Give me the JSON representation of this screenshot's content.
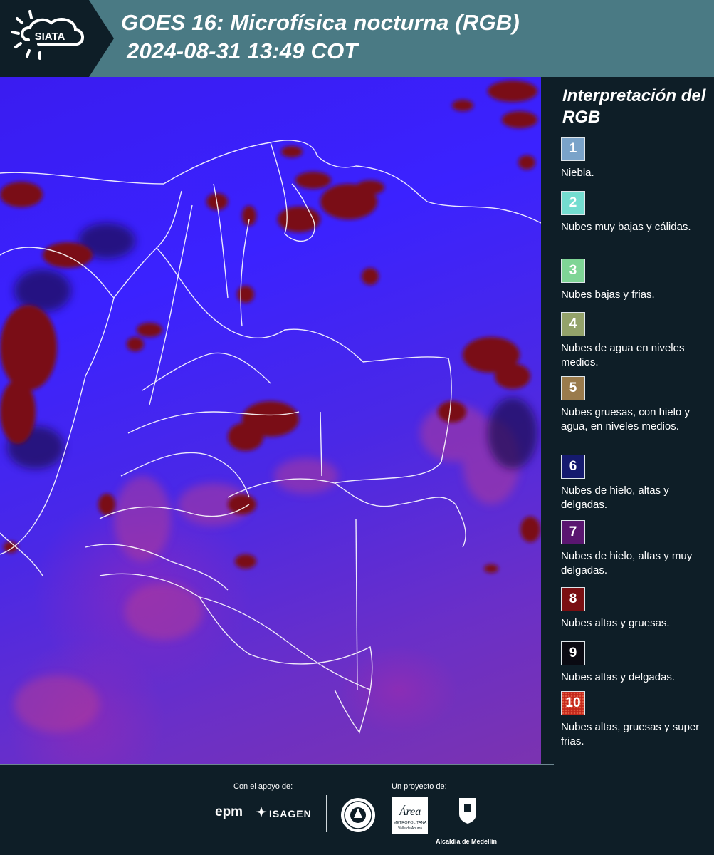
{
  "header": {
    "logo_text": "SIATA",
    "title_line1": "GOES 16: Microfísica nocturna (RGB)",
    "title_line2": "2024-08-31 13:49 COT",
    "background_color": "#4a7a84"
  },
  "legend": {
    "title": "Interpretación del RGB",
    "items": [
      {
        "number": "1",
        "color": "#7aa3c9",
        "text": "Niebla."
      },
      {
        "number": "2",
        "color": "#74ddd0",
        "text": "Nubes muy bajas y cálidas."
      },
      {
        "number": "3",
        "color": "#7fd596",
        "text": "Nubes bajas y frias."
      },
      {
        "number": "4",
        "color": "#93a26a",
        "text": "Nubes de agua en niveles medios."
      },
      {
        "number": "5",
        "color": "#9a7b4c",
        "text": "Nubes gruesas, con hielo y agua, en niveles medios."
      },
      {
        "number": "6",
        "color": "#151a6e",
        "text": "Nubes de hielo, altas y delgadas."
      },
      {
        "number": "7",
        "color": "#5a1670",
        "text": "Nubes de hielo, altas y muy delgadas."
      },
      {
        "number": "8",
        "color": "#7a0f12",
        "text": "Nubes altas y gruesas."
      },
      {
        "number": "9",
        "color": "#0a0a12",
        "text": "Nubes altas y delgadas."
      },
      {
        "number": "10",
        "color": "#c3271b",
        "text": "Nubes altas, gruesas y super frias."
      }
    ]
  },
  "footer": {
    "support_label": "Con el apoyo de:",
    "project_label": "Un proyecto de:",
    "sponsor1": "epm",
    "sponsor2": "ISAGEN",
    "partner_area_line1": "Área",
    "partner_area_line2": "METROPOLITANA",
    "partner_area_line3": "Valle de Aburrá",
    "partner_alcaldia": "Alcaldía de Medellín"
  }
}
